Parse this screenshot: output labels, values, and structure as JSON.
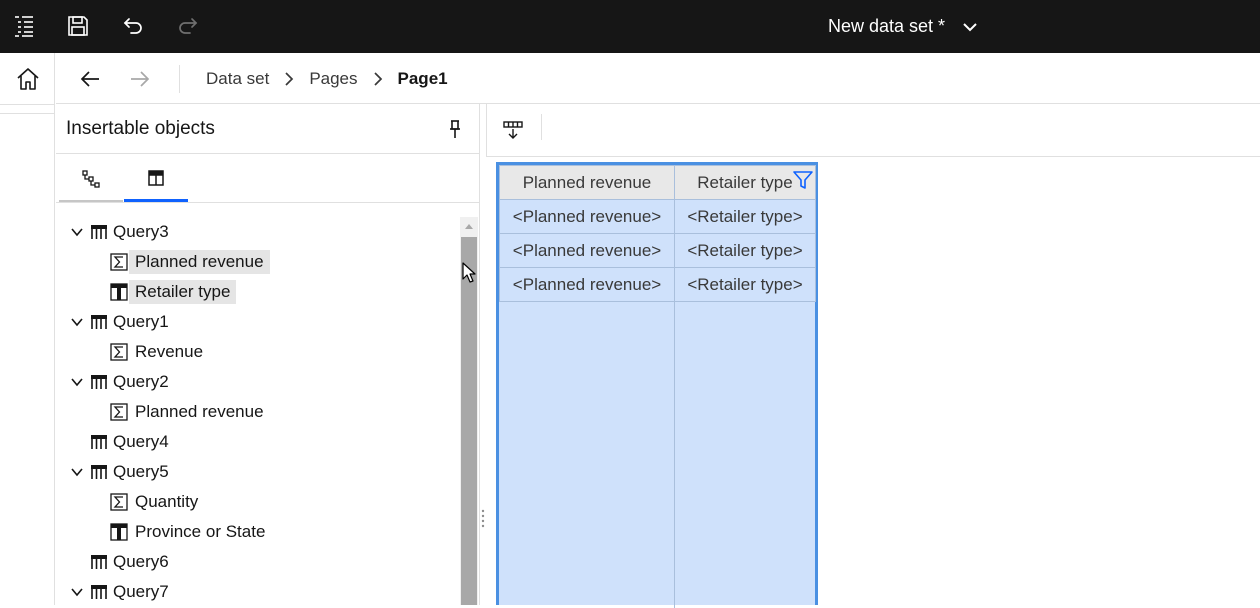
{
  "topbar": {
    "doc_title": "New data set *",
    "icons": [
      "menu-icon",
      "save-icon",
      "undo-icon",
      "redo-icon",
      "chevron-down-icon"
    ]
  },
  "rail": {
    "icons": [
      "home-icon"
    ]
  },
  "breadcrumb": {
    "items": [
      "Data set",
      "Pages",
      "Page1"
    ],
    "icons": [
      "arrow-left-icon",
      "arrow-right-icon",
      "chevron-right-icon"
    ]
  },
  "panel": {
    "title": "Insertable objects",
    "tabs": [
      {
        "icon": "source-tree-icon",
        "active": false
      },
      {
        "icon": "data-items-icon",
        "active": true
      }
    ],
    "tree": [
      {
        "label": "Query3",
        "type": "query",
        "level": 0,
        "expanded": true
      },
      {
        "label": "Planned revenue",
        "type": "measure",
        "level": 1,
        "selected": true
      },
      {
        "label": "Retailer type",
        "type": "attribute",
        "level": 1,
        "selected": true
      },
      {
        "label": "Query1",
        "type": "query",
        "level": 0,
        "expanded": true
      },
      {
        "label": "Revenue",
        "type": "measure",
        "level": 1
      },
      {
        "label": "Query2",
        "type": "query",
        "level": 0,
        "expanded": true
      },
      {
        "label": "Planned revenue",
        "type": "measure",
        "level": 1
      },
      {
        "label": "Query4",
        "type": "query",
        "level": 0
      },
      {
        "label": "Query5",
        "type": "query",
        "level": 0,
        "expanded": true
      },
      {
        "label": "Quantity",
        "type": "measure",
        "level": 1
      },
      {
        "label": "Province or State",
        "type": "attribute",
        "level": 1
      },
      {
        "label": "Query6",
        "type": "query",
        "level": 0
      },
      {
        "label": "Query7",
        "type": "query",
        "level": 0,
        "expanded": true
      }
    ]
  },
  "work": {
    "toolbar": {
      "icons": [
        "insert-column-icon"
      ]
    },
    "list": {
      "headers": [
        "Planned revenue",
        "Retailer type"
      ],
      "rows": [
        [
          "<Planned revenue>",
          "<Retailer type>"
        ],
        [
          "<Planned revenue>",
          "<Retailer type>"
        ],
        [
          "<Planned revenue>",
          "<Retailer type>"
        ]
      ],
      "filter_icon": "filter-icon"
    }
  },
  "colors": {
    "topbar_bg": "#161616",
    "accent": "#0f62fe",
    "list_bg": "#cfe1fb",
    "list_border": "#4a90e2"
  }
}
